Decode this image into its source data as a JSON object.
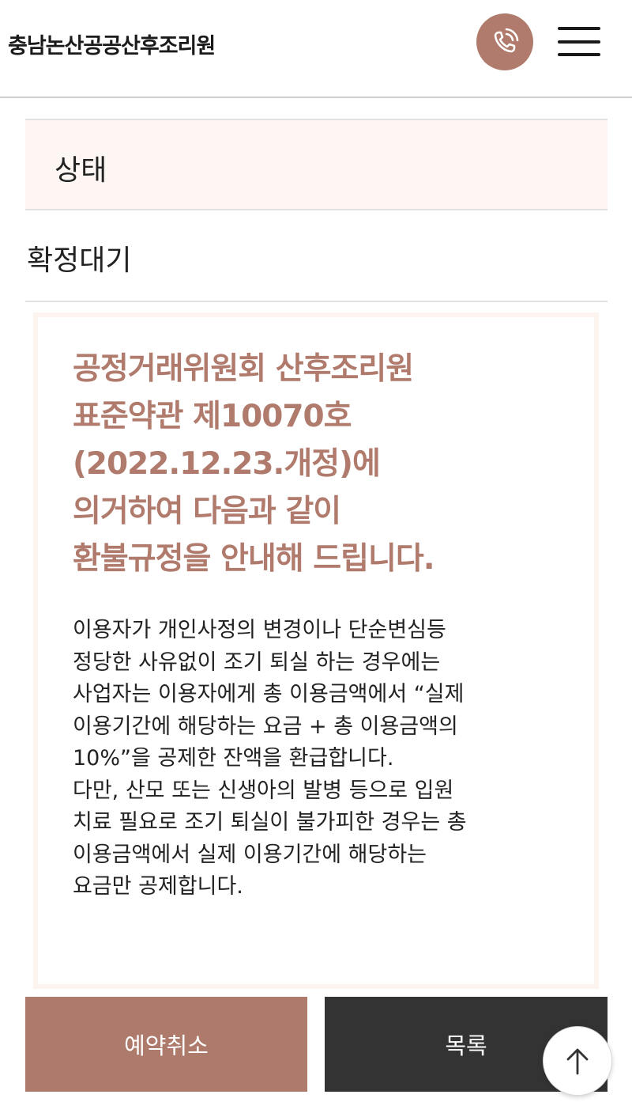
{
  "header": {
    "logo": "충남논산공공산후조리원",
    "call_icon": "phone-icon",
    "menu_icon": "hamburger-menu-icon"
  },
  "status": {
    "label": "상태",
    "value": "확정대기"
  },
  "notice": {
    "title_lines": [
      "공정거래위원회 산후조리원",
      "표준약관 제10070호",
      "(2022.12.23.개정)에",
      "의거하여 다음과 같이",
      "환불규정을 안내해 드립니다."
    ],
    "body_lines": [
      "이용자가 개인사정의 변경이나 단순변심등",
      "정당한 사유없이 조기 퇴실 하는 경우에는",
      "사업자는 이용자에게 총 이용금액에서 “실제",
      "이용기간에 해당하는 요금 + 총 이용금액의",
      "10%”을 공제한 잔액을 환급합니다.",
      "다만, 산모 또는 신생아의 발병 등으로 입원",
      "치료 필요로 조기 퇴실이 불가피한 경우는 총",
      "이용금액에서 실제 이용기간에 해당하는",
      "요금만 공제합니다."
    ]
  },
  "actions": {
    "cancel_label": "예약취소",
    "list_label": "목록",
    "scroll_top_icon": "arrow-up-icon"
  },
  "colors": {
    "accent": "#b07b6c",
    "dark_button": "#333333",
    "label_bg": "#fdf6f3"
  }
}
